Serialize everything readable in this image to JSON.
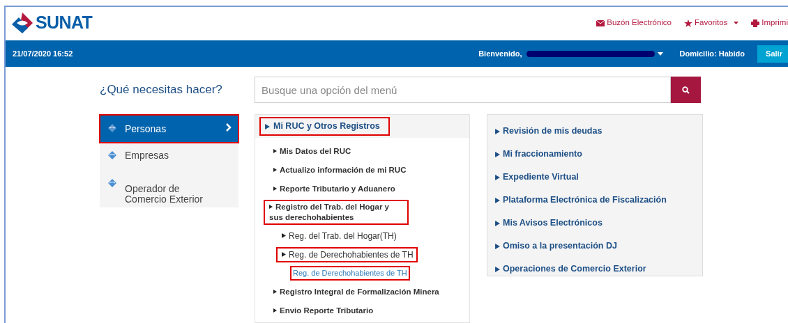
{
  "header": {
    "logo_text": "SUNAT",
    "links": [
      {
        "kind": "mail",
        "label": "Buzón Electrónico",
        "dropdown": false
      },
      {
        "kind": "favorites",
        "label": "Favoritos",
        "dropdown": true
      },
      {
        "kind": "print",
        "label": "Imprimi",
        "dropdown": false
      }
    ]
  },
  "user_bar": {
    "datetime": "21/07/2020 16:52",
    "greeting": "Bienvenido,",
    "domicile": "Domicilio: Habido",
    "logout": "Salir"
  },
  "question": "¿Qué necesitas hacer?",
  "search": {
    "placeholder": "Busque una opción del menú"
  },
  "categories": [
    {
      "label": "Personas",
      "selected": true,
      "highlighted": true
    },
    {
      "label": "Empresas",
      "selected": false,
      "highlighted": false
    },
    {
      "label": "Operador de Comercio Exterior",
      "selected": false,
      "highlighted": false
    }
  ],
  "menu": {
    "title": "Mi RUC y Otros Registros",
    "highlighted": true,
    "children": [
      {
        "label": "Mis Datos del RUC",
        "highlighted": false
      },
      {
        "label": "Actualizo información de mi RUC",
        "highlighted": false
      },
      {
        "label": "Reporte Tributario y Aduanero",
        "highlighted": false
      },
      {
        "label": "Registro del Trab. del Hogar y sus derechohabientes",
        "highlighted": true,
        "children": [
          {
            "label": "Reg. del Trab. del Hogar(TH)",
            "highlighted": false
          },
          {
            "label": "Reg. de Derechohabientes de TH",
            "highlighted": true,
            "children": [
              {
                "label": "Reg. de Derechohabientes de TH",
                "kind": "link",
                "highlighted": true
              }
            ]
          }
        ]
      },
      {
        "label": "Registro Integral de Formalización Minera",
        "highlighted": false
      },
      {
        "label": "Envio Reporte Tributario",
        "highlighted": false
      }
    ]
  },
  "quick_links": [
    "Revisión de mis deudas",
    "Mi fraccionamiento",
    "Expediente Virtual",
    "Plataforma Electrónica de Fiscalización",
    "Mis Avisos Electrónicos",
    "Omiso a la presentación DJ",
    "Operaciones de Comercio Exterior"
  ]
}
